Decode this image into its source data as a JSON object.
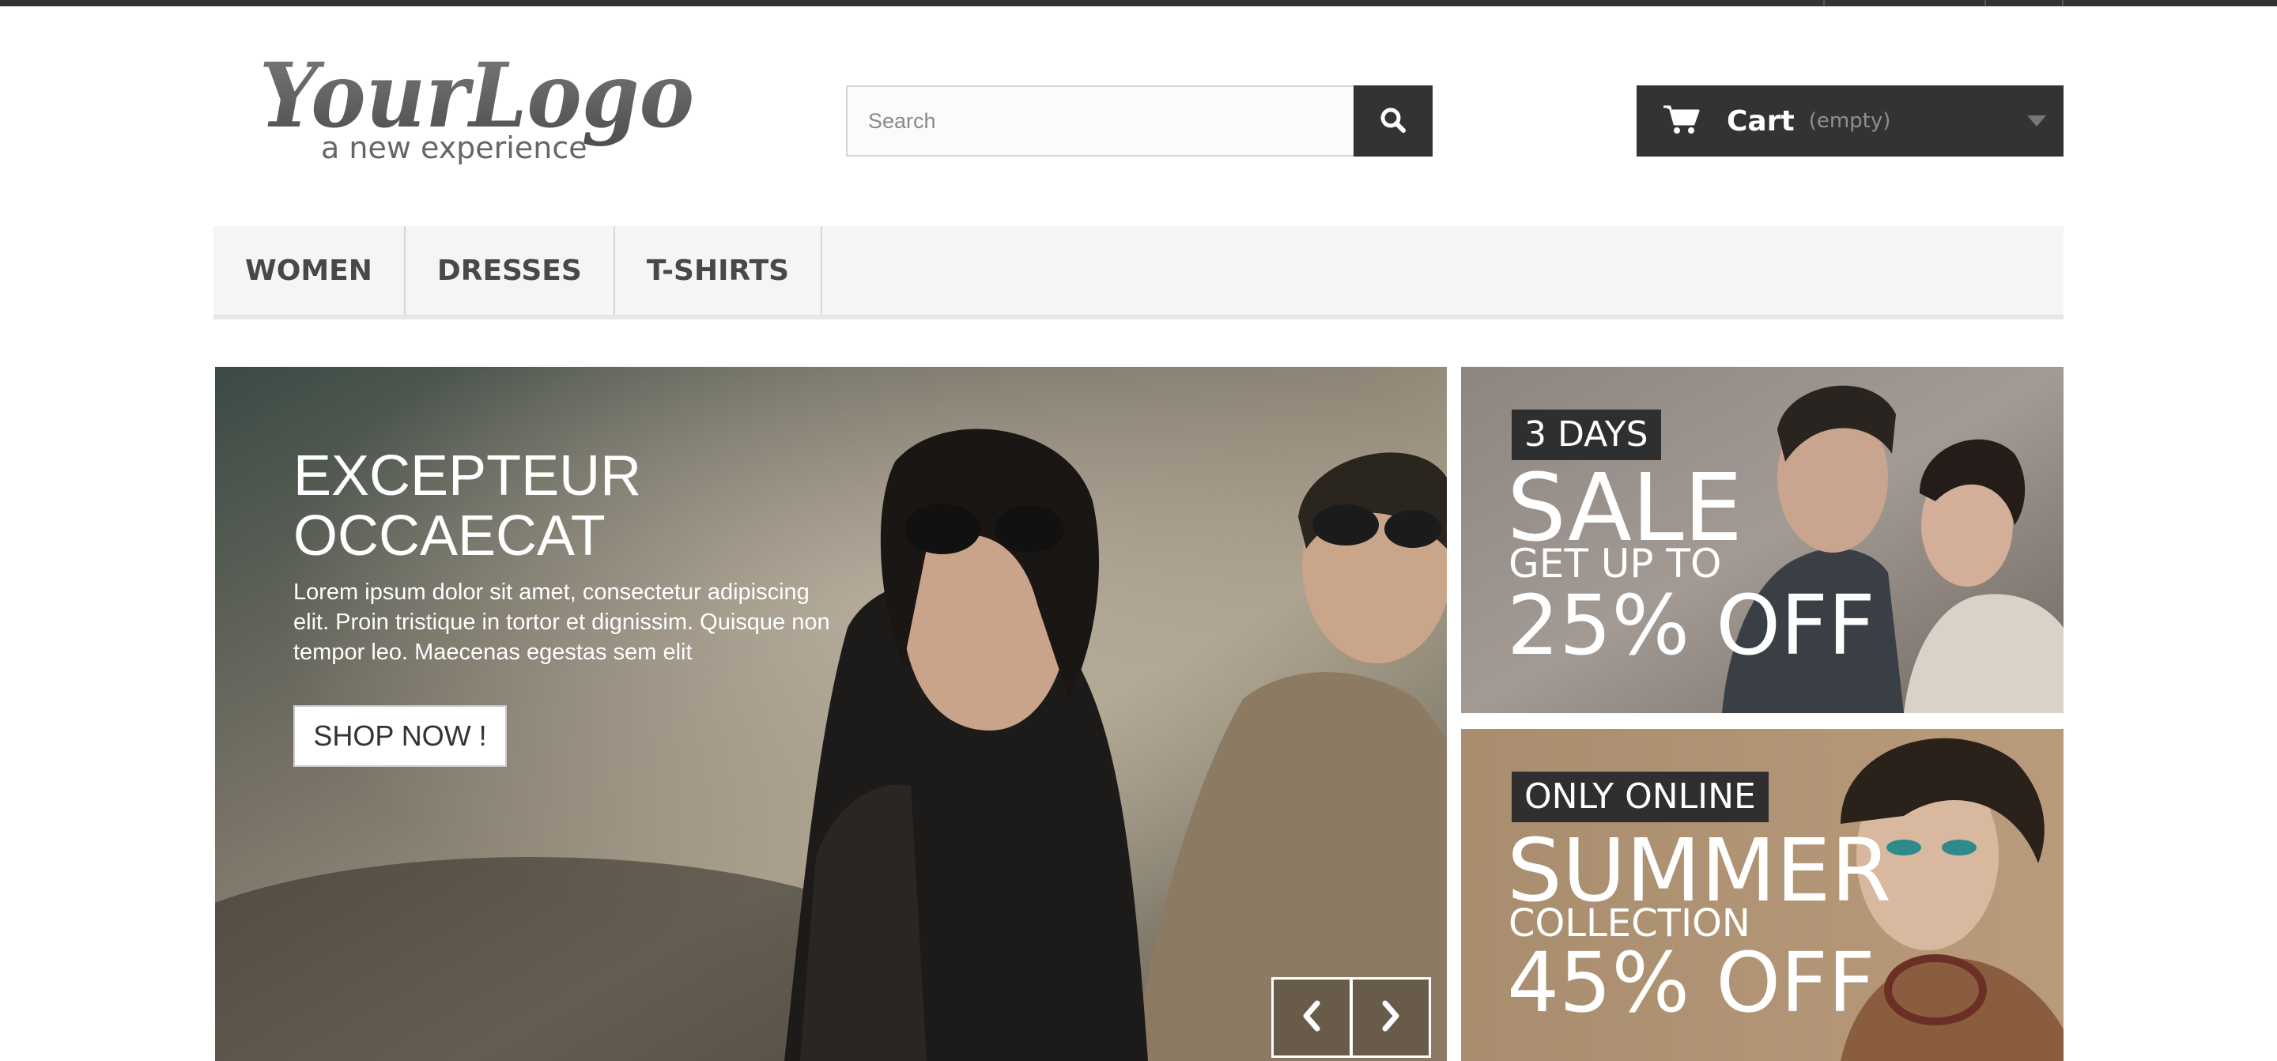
{
  "logo": {
    "main": "YourLogo",
    "tagline": "a new experience"
  },
  "search": {
    "placeholder": "Search",
    "icon": "search-icon"
  },
  "cart": {
    "label": "Cart",
    "status": "(empty)",
    "icon": "shopping-cart-icon"
  },
  "menu": {
    "items": [
      {
        "label": "WOMEN"
      },
      {
        "label": "DRESSES"
      },
      {
        "label": "T-SHIRTS"
      }
    ]
  },
  "hero": {
    "title": "EXCEPTEUR OCCAECAT",
    "text": "Lorem ipsum dolor sit amet, consectetur adipiscing elit. Proin tristique in tortor et dignissim. Quisque non tempor leo. Maecenas egestas sem elit",
    "button": "SHOP NOW !"
  },
  "banners": [
    {
      "tag": "3 DAYS",
      "big": "SALE",
      "mid": "GET UP TO",
      "offer": "25% OFF"
    },
    {
      "tag": "ONLY ONLINE",
      "big": "SUMMER",
      "mid": "COLLECTION",
      "offer": "45% OFF"
    }
  ],
  "colors": {
    "dark": "#333333",
    "menu_bg": "#f5f5f5",
    "banner_tag": "#2f2f2f"
  }
}
